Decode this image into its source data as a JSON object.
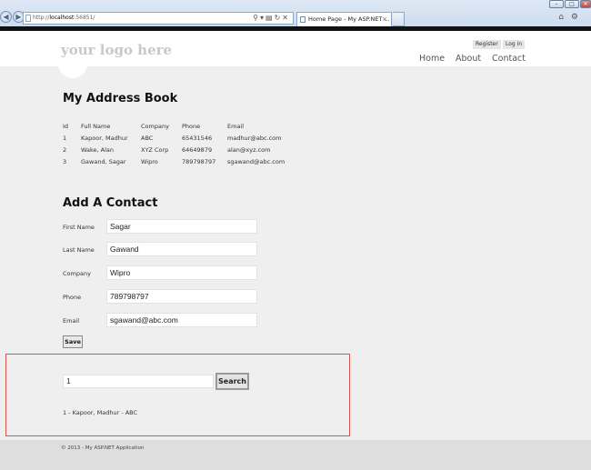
{
  "browser": {
    "url_prefix": "http://",
    "url_host": "localhost",
    "url_rest": ":56851/",
    "tab_title": "Home Page - My ASP.NET ...",
    "tab_close": "×"
  },
  "header": {
    "logo": "your logo here",
    "register": "Register",
    "login": "Log in",
    "nav": [
      "Home",
      "About",
      "Contact"
    ]
  },
  "address_book": {
    "title": "My Address Book",
    "columns": [
      "Id",
      "Full Name",
      "Company",
      "Phone",
      "Email"
    ],
    "rows": [
      [
        "1",
        "Kapoor, Madhur",
        "ABC",
        "65431546",
        "madhur@abc.com"
      ],
      [
        "2",
        "Wake, Alan",
        "XYZ Corp",
        "64649879",
        "alan@xyz.com"
      ],
      [
        "3",
        "Gawand, Sagar",
        "Wipro",
        "789798797",
        "sgawand@abc.com"
      ]
    ]
  },
  "add_contact": {
    "title": "Add A Contact",
    "fields": [
      {
        "label": "First Name",
        "value": "Sagar"
      },
      {
        "label": "Last Name",
        "value": "Gawand"
      },
      {
        "label": "Company",
        "value": "Wipro"
      },
      {
        "label": "Phone",
        "value": "789798797"
      },
      {
        "label": "Email",
        "value": "sgawand@abc.com"
      }
    ],
    "save_label": "Save"
  },
  "search": {
    "value": "1",
    "button_label": "Search",
    "result": "1 - Kapoor, Madhur - ABC"
  },
  "footer": {
    "text": "© 2013 - My ASP.NET Application"
  },
  "colors": {
    "search_border": "#d9534f",
    "page_bg": "#efefef"
  }
}
